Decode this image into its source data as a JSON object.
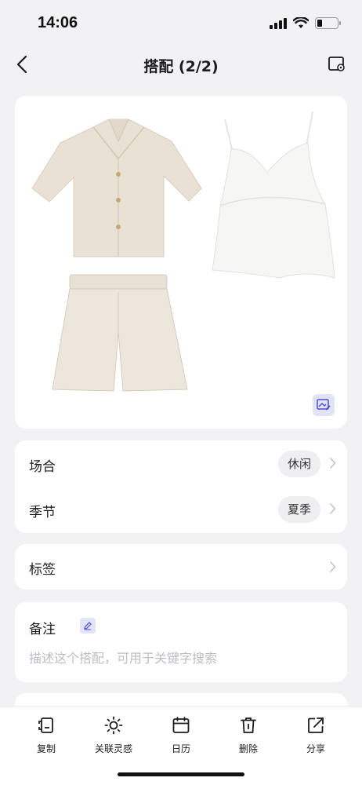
{
  "status": {
    "time": "14:06",
    "battery_level": 0.25
  },
  "nav": {
    "title": "搭配 (2/2)",
    "back_icon": "chevron-left-icon",
    "action_icon": "image-settings-icon"
  },
  "outfit": {
    "items": [
      "linen-shirt",
      "camisole-top",
      "linen-shorts"
    ],
    "edit_icon": "image-edit-icon"
  },
  "attributes": [
    {
      "label": "场合",
      "value": "休闲"
    },
    {
      "label": "季节",
      "value": "夏季"
    }
  ],
  "tags": {
    "label": "标签"
  },
  "note": {
    "title": "备注",
    "placeholder": "描述这个搭配，可用于关键字搜索"
  },
  "toolbar": [
    {
      "label": "复制",
      "icon": "copy-icon"
    },
    {
      "label": "关联灵感",
      "icon": "sun-icon"
    },
    {
      "label": "日历",
      "icon": "calendar-icon"
    },
    {
      "label": "删除",
      "icon": "trash-icon"
    },
    {
      "label": "分享",
      "icon": "share-icon"
    }
  ],
  "colors": {
    "accent": "#e2e3f6",
    "background": "#f2f2f4"
  }
}
